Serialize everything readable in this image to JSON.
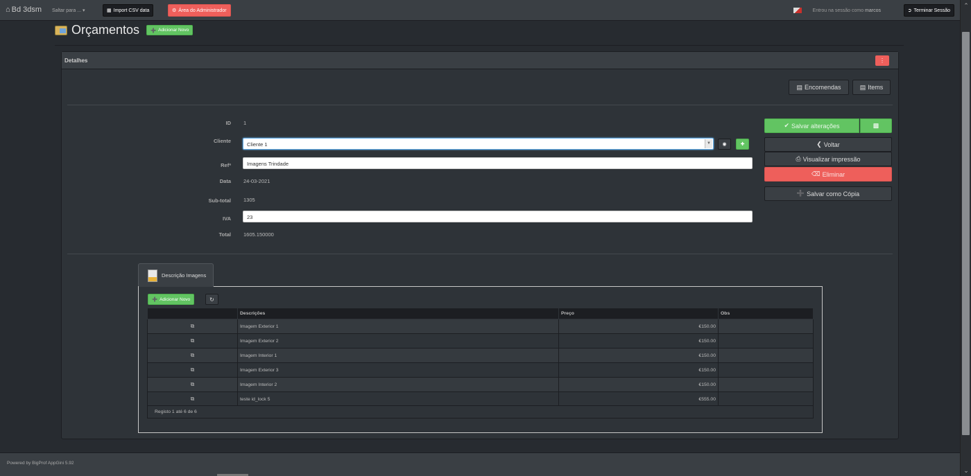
{
  "navbar": {
    "brand": "Bd 3dsm",
    "jump_label": "Saltar para ...",
    "csv_label": "Import CSV data",
    "admin_label": "Área do Administrador",
    "session_prefix": "Entrou na sessão como",
    "session_user": "marcos",
    "logout_label": "Terminar Sessão"
  },
  "page": {
    "title": "Orçamentos",
    "add_new_label": "Adicionar Novo"
  },
  "panel": {
    "title": "Detalhes",
    "dots": "⋮",
    "encomendas_label": "Encomendas",
    "items_label": "Items"
  },
  "fields": {
    "id_label": "ID",
    "id_value": "1",
    "cliente_label": "Cliente",
    "cliente_value": "Cliente 1",
    "ref_label": "Refª",
    "ref_value": "Imagens Trindade",
    "data_label": "Data",
    "data_value": "24-03-2021",
    "subtotal_label": "Sub-total",
    "subtotal_value": "1305",
    "iva_label": "IVA",
    "iva_value": "23",
    "total_label": "Total",
    "total_value": "1605.150000"
  },
  "actions": {
    "save_label": "Salvar alterações",
    "back_label": "Voltar",
    "print_label": "Visualizar impressão",
    "delete_label": "Eliminar",
    "copy_label": "Salvar como Cópia"
  },
  "subtable": {
    "tab_label": "Descrição Imagens",
    "add_new_label": "Adicionar Novo",
    "columns": [
      "Descrições",
      "Preço",
      "Obs"
    ],
    "rows": [
      {
        "descricao": "Imagem Exterior 1",
        "preco": "€150.00",
        "obs": ""
      },
      {
        "descricao": "Imagem Exterior 2",
        "preco": "€150.00",
        "obs": ""
      },
      {
        "descricao": "Imagem Interior 1",
        "preco": "€150.00",
        "obs": ""
      },
      {
        "descricao": "Imagem Exterior 3",
        "preco": "€150.00",
        "obs": ""
      },
      {
        "descricao": "Imagem Interior 2",
        "preco": "€150.00",
        "obs": ""
      },
      {
        "descricao": "teste id_lock 5",
        "preco": "€555.00",
        "obs": ""
      }
    ],
    "footer": "Registo 1 até 6 de 6"
  },
  "footer": {
    "text": "Powered by BigProf AppGini 5.92"
  },
  "colors": {
    "success": "#62c462",
    "danger": "#ee5f5b",
    "background": "#272b30"
  }
}
